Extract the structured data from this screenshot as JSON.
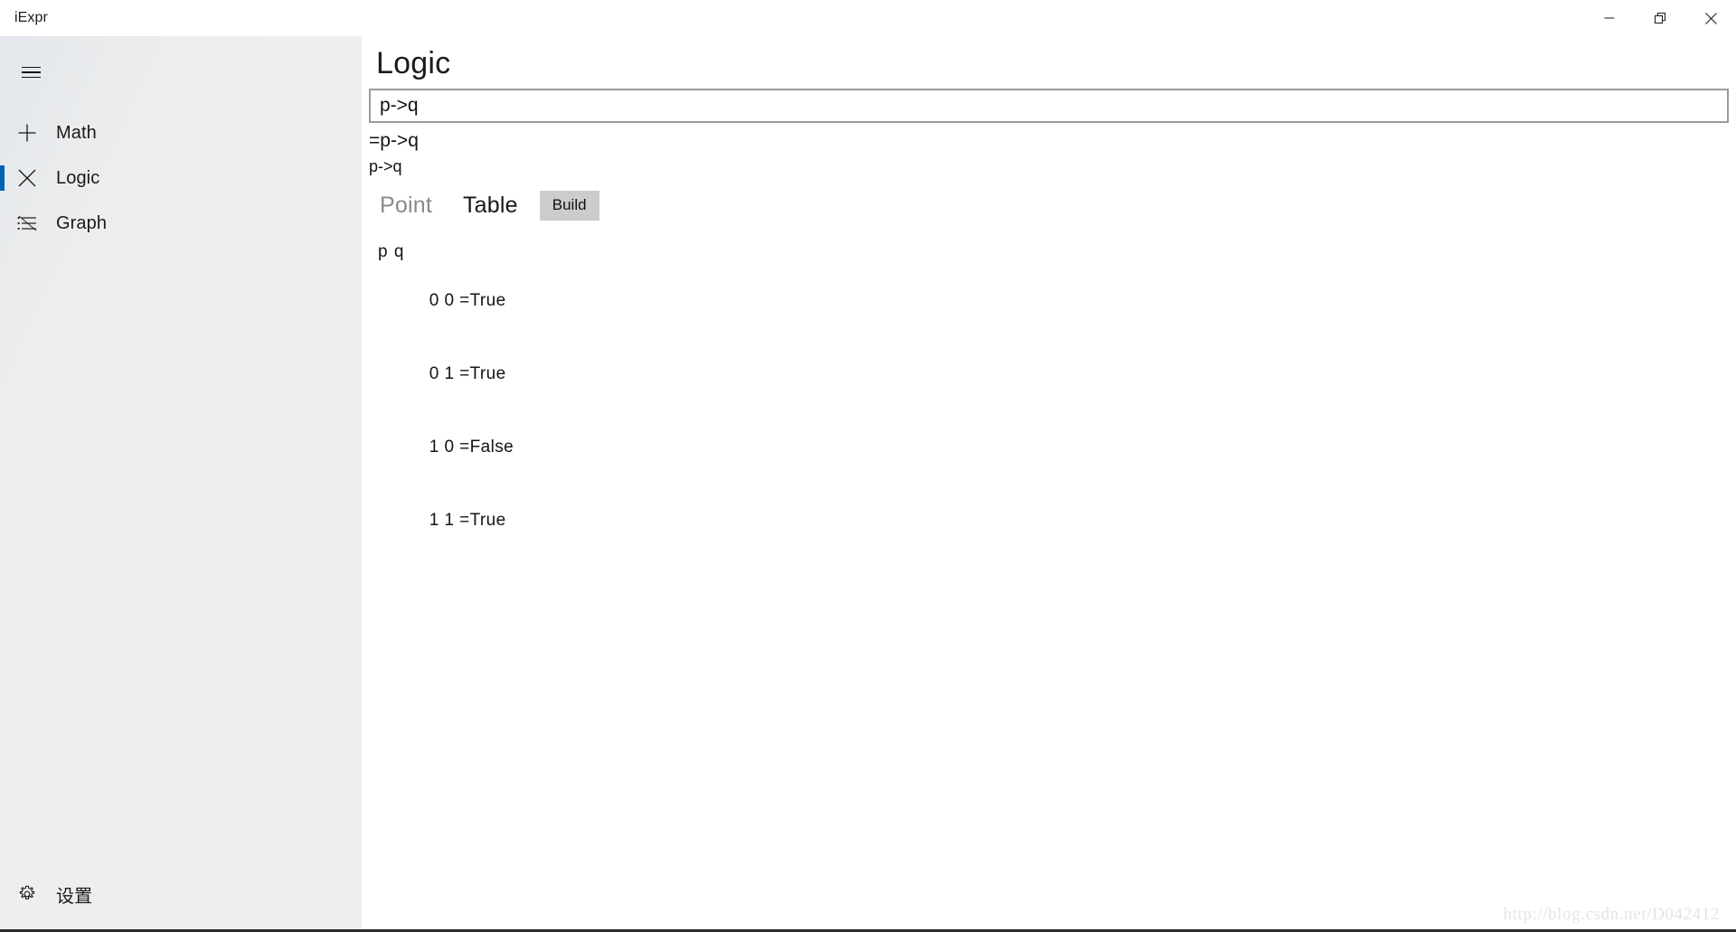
{
  "window": {
    "title": "iExpr",
    "controls": {
      "minimize_label": "Minimize",
      "restore_label": "Restore",
      "close_label": "Close"
    }
  },
  "theme": {
    "accent": "#0063B1",
    "sidebar_bg": "#ECECEC",
    "content_bg": "#FFFFFF",
    "button_bg": "#CCCCCC",
    "input_border": "#9B9B9B",
    "inactive_tab": "#8A8A8A",
    "watermark_color": "#E4E4E4"
  },
  "sidebar": {
    "menu_button": "hamburger-menu",
    "items": [
      {
        "label": "Math",
        "icon": "plus-icon",
        "selected": false
      },
      {
        "label": "Logic",
        "icon": "close-x-icon",
        "selected": true
      },
      {
        "label": "Graph",
        "icon": "list-icon",
        "selected": false
      }
    ],
    "settings": {
      "label": "设置",
      "icon": "gear-icon"
    }
  },
  "main": {
    "page_title": "Logic",
    "input": {
      "value": "p->q",
      "placeholder": ""
    },
    "results": {
      "line1": "=p->q",
      "line2": "p->q"
    },
    "tabs": [
      {
        "label": "Point",
        "active": false
      },
      {
        "label": "Table",
        "active": true
      }
    ],
    "build_button": "Build",
    "truth_table": {
      "header": "p q",
      "variables": [
        "p",
        "q"
      ],
      "rows": [
        {
          "values": "0 0",
          "eq": "=",
          "result": "True"
        },
        {
          "values": "0 1",
          "eq": "=",
          "result": "True"
        },
        {
          "values": "1 0",
          "eq": "=",
          "result": "False"
        },
        {
          "values": "1 1",
          "eq": "=",
          "result": "True"
        }
      ]
    }
  },
  "watermark": {
    "text": "http://blog.csdn.net/D042412"
  }
}
